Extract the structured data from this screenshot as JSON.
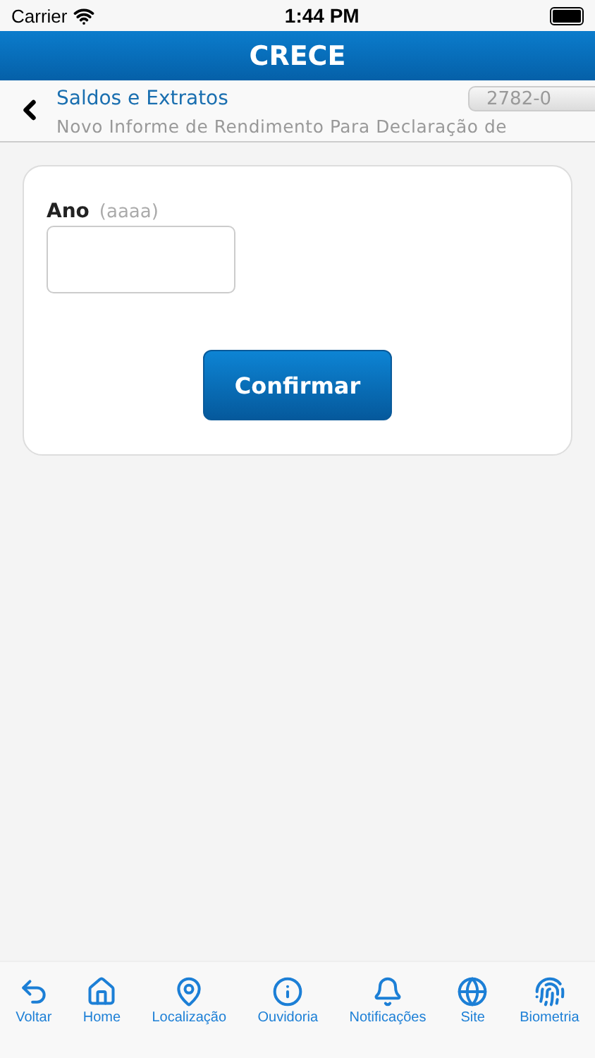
{
  "status_bar": {
    "carrier": "Carrier",
    "time": "1:44 PM"
  },
  "header": {
    "title": "CRECE"
  },
  "breadcrumb": {
    "section": "Saldos e Extratos",
    "account": "2782-0",
    "subtitle": "Novo Informe de Rendimento Para Declaração de"
  },
  "form": {
    "label": "Ano",
    "hint": "(aaaa)",
    "button": "Confirmar"
  },
  "tab_bar": [
    {
      "kind": "back",
      "label": "Voltar"
    },
    {
      "kind": "home",
      "label": "Home"
    },
    {
      "kind": "location",
      "label": "Localização"
    },
    {
      "kind": "info",
      "label": "Ouvidoria"
    },
    {
      "kind": "bell",
      "label": "Notificações"
    },
    {
      "kind": "globe",
      "label": "Site"
    },
    {
      "kind": "fingerprint",
      "label": "Biometria"
    }
  ]
}
